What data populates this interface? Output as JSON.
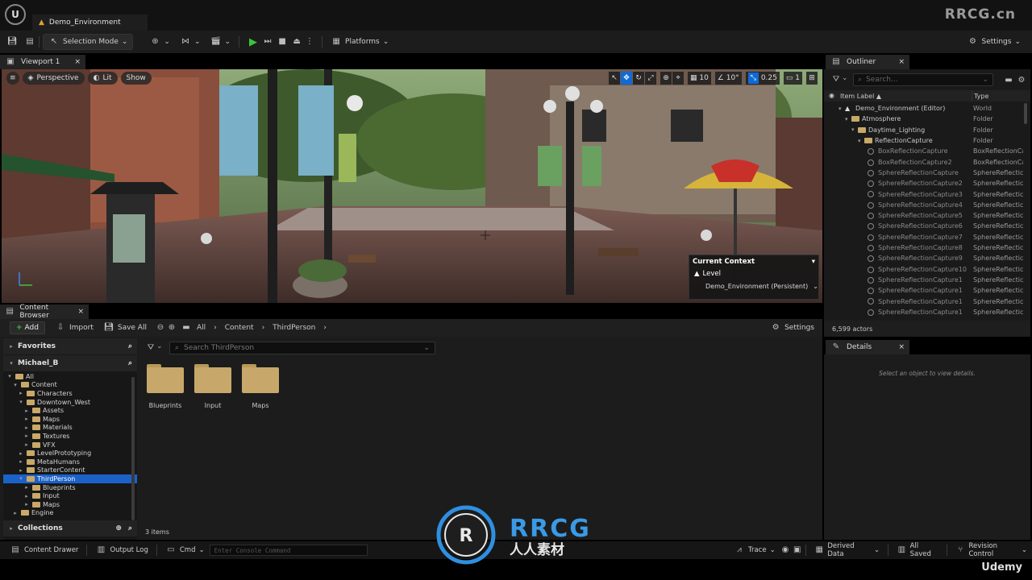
{
  "app": {
    "document_tab": "Demo_Environment",
    "watermark": "RRCG.cn",
    "logo_text": "RRCG",
    "logo_subtext": "人人素材",
    "footer_brand": "Udemy"
  },
  "toolbar": {
    "selection_mode": "Selection Mode",
    "platforms": "Platforms",
    "settings": "Settings"
  },
  "viewport": {
    "tab_label": "Viewport 1",
    "perspective": "Perspective",
    "lit": "Lit",
    "show": "Show",
    "grid_value": "10",
    "angle_value": "10°",
    "scale_value": "0.25",
    "camera_speed": "1",
    "context": {
      "title": "Current Context",
      "level_label": "Level",
      "level_value": "Demo_Environment (Persistent)"
    }
  },
  "content_browser": {
    "tab_label": "Content Browser",
    "add": "Add",
    "import": "Import",
    "save_all": "Save All",
    "breadcrumb": [
      "All",
      "Content",
      "ThirdPerson"
    ],
    "settings": "Settings",
    "favorites": "Favorites",
    "user_section": "Michael_B",
    "collections": "Collections",
    "search_placeholder": "Search ThirdPerson",
    "item_count": "3 items",
    "tree": [
      {
        "label": "All",
        "depth": 0,
        "expanded": true
      },
      {
        "label": "Content",
        "depth": 1,
        "expanded": true
      },
      {
        "label": "Characters",
        "depth": 2,
        "expanded": false
      },
      {
        "label": "Downtown_West",
        "depth": 2,
        "expanded": true
      },
      {
        "label": "Assets",
        "depth": 3,
        "expanded": false
      },
      {
        "label": "Maps",
        "depth": 3,
        "expanded": false
      },
      {
        "label": "Materials",
        "depth": 3,
        "expanded": false
      },
      {
        "label": "Textures",
        "depth": 3,
        "expanded": false
      },
      {
        "label": "VFX",
        "depth": 3,
        "expanded": false
      },
      {
        "label": "LevelPrototyping",
        "depth": 2,
        "expanded": false
      },
      {
        "label": "MetaHumans",
        "depth": 2,
        "expanded": false
      },
      {
        "label": "StarterContent",
        "depth": 2,
        "expanded": false
      },
      {
        "label": "ThirdPerson",
        "depth": 2,
        "expanded": true,
        "selected": true
      },
      {
        "label": "Blueprints",
        "depth": 3,
        "expanded": false
      },
      {
        "label": "Input",
        "depth": 3,
        "expanded": false
      },
      {
        "label": "Maps",
        "depth": 3,
        "expanded": false
      },
      {
        "label": "Engine",
        "depth": 1,
        "expanded": false
      }
    ],
    "folders": [
      "Blueprints",
      "Input",
      "Maps"
    ]
  },
  "outliner": {
    "tab_label": "Outliner",
    "search_placeholder": "Search...",
    "col_label": "Item Label ▲",
    "col_type": "Type",
    "actor_count": "6,599 actors",
    "rows": [
      {
        "label": "Demo_Environment (Editor)",
        "type": "World",
        "depth": 1
      },
      {
        "label": "Atmosphere",
        "type": "Folder",
        "depth": 2
      },
      {
        "label": "Daytime_Lighting",
        "type": "Folder",
        "depth": 3
      },
      {
        "label": "ReflectionCapture",
        "type": "Folder",
        "depth": 4
      },
      {
        "label": "BoxReflectionCapture",
        "type": "BoxReflectionCa",
        "depth": 5,
        "dim": true
      },
      {
        "label": "BoxReflectionCapture2",
        "type": "BoxReflectionCa",
        "depth": 5,
        "dim": true
      },
      {
        "label": "SphereReflectionCapture",
        "type": "SphereReflectic",
        "depth": 5,
        "dim": true
      },
      {
        "label": "SphereReflectionCapture2",
        "type": "SphereReflectic",
        "depth": 5,
        "dim": true
      },
      {
        "label": "SphereReflectionCapture3",
        "type": "SphereReflectic",
        "depth": 5,
        "dim": true
      },
      {
        "label": "SphereReflectionCapture4",
        "type": "SphereReflectic",
        "depth": 5,
        "dim": true
      },
      {
        "label": "SphereReflectionCapture5",
        "type": "SphereReflectic",
        "depth": 5,
        "dim": true
      },
      {
        "label": "SphereReflectionCapture6",
        "type": "SphereReflectic",
        "depth": 5,
        "dim": true
      },
      {
        "label": "SphereReflectionCapture7",
        "type": "SphereReflectic",
        "depth": 5,
        "dim": true
      },
      {
        "label": "SphereReflectionCapture8",
        "type": "SphereReflectic",
        "depth": 5,
        "dim": true
      },
      {
        "label": "SphereReflectionCapture9",
        "type": "SphereReflectic",
        "depth": 5,
        "dim": true
      },
      {
        "label": "SphereReflectionCapture10",
        "type": "SphereReflectic",
        "depth": 5,
        "dim": true
      },
      {
        "label": "SphereReflectionCapture1",
        "type": "SphereReflectic",
        "depth": 5,
        "dim": true
      },
      {
        "label": "SphereReflectionCapture1",
        "type": "SphereReflectic",
        "depth": 5,
        "dim": true
      },
      {
        "label": "SphereReflectionCapture1",
        "type": "SphereReflectic",
        "depth": 5,
        "dim": true
      },
      {
        "label": "SphereReflectionCapture1",
        "type": "SphereReflectic",
        "depth": 5,
        "dim": true
      }
    ]
  },
  "details": {
    "tab_label": "Details",
    "empty_hint": "Select an object to view details."
  },
  "status_bar": {
    "content_drawer": "Content Drawer",
    "output_log": "Output Log",
    "cmd": "Cmd",
    "console_placeholder": "Enter Console Command",
    "trace": "Trace",
    "derived_data": "Derived Data",
    "all_saved": "All Saved",
    "revision_control": "Revision Control"
  },
  "colors": {
    "accent": "#1b62c8",
    "play": "#3cc43c",
    "folder": "#c7a86a"
  }
}
